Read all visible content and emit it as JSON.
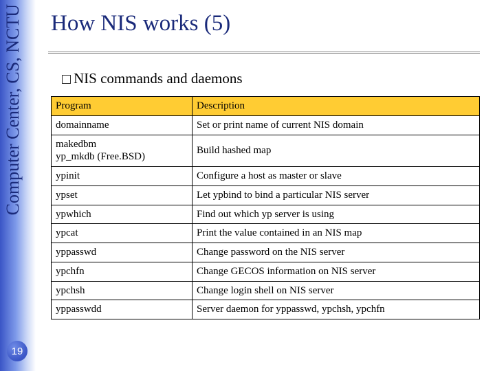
{
  "sidebar": {
    "org_text": "Computer Center, CS, NCTU"
  },
  "page_number": "19",
  "title": "How NIS works (5)",
  "subtitle": "NIS commands and daemons",
  "table": {
    "headers": {
      "program": "Program",
      "description": "Description"
    },
    "rows": [
      {
        "program": "domainname",
        "description": "Set or print name of current NIS domain"
      },
      {
        "program": "makedbm\nyp_mkdb (Free.BSD)",
        "description": "Build hashed map"
      },
      {
        "program": "ypinit",
        "description": "Configure a host as master or slave"
      },
      {
        "program": "ypset",
        "description": "Let ypbind to bind a particular NIS server"
      },
      {
        "program": "ypwhich",
        "description": "Find out which yp server is using"
      },
      {
        "program": "ypcat",
        "description": "Print the value contained in an NIS map"
      },
      {
        "program": "yppasswd",
        "description": "Change password on the NIS server"
      },
      {
        "program": "ypchfn",
        "description": "Change GECOS information on NIS server"
      },
      {
        "program": "ypchsh",
        "description": "Change login shell on NIS server"
      },
      {
        "program": "yppasswdd",
        "description": "Server daemon for yppasswd, ypchsh, ypchfn"
      }
    ]
  }
}
